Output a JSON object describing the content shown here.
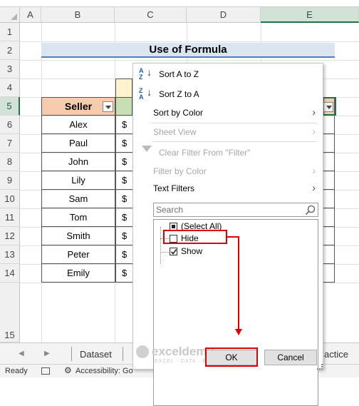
{
  "columns": [
    "A",
    "B",
    "C",
    "D",
    "E"
  ],
  "rows": [
    "1",
    "2",
    "3",
    "4",
    "5",
    "6",
    "7",
    "8",
    "9",
    "10",
    "11",
    "12",
    "13",
    "14",
    "15"
  ],
  "title": "Use of Formula",
  "table": {
    "header": "Seller",
    "sellers": [
      "Alex",
      "Paul",
      "John",
      "Lily",
      "Sam",
      "Tom",
      "Smith",
      "Peter",
      "Emily"
    ],
    "currency": "$"
  },
  "menu": {
    "sort_az": "Sort A to Z",
    "sort_za": "Sort Z to A",
    "sort_by_color": "Sort by Color",
    "sheet_view": "Sheet View",
    "clear_filter": "Clear Filter From \"Filter\"",
    "filter_by_color": "Filter by Color",
    "text_filters": "Text Filters",
    "search_placeholder": "Search",
    "items": [
      {
        "label": "(Select All)",
        "state": "partial"
      },
      {
        "label": "Hide",
        "state": "unchecked"
      },
      {
        "label": "Show",
        "state": "checked"
      }
    ],
    "ok": "OK",
    "cancel": "Cancel"
  },
  "tabs": {
    "dataset": "Dataset",
    "practice": "actice"
  },
  "status": {
    "ready": "Ready",
    "accessibility": "Accessibility: Go"
  },
  "watermark": {
    "brand": "exceldemy",
    "tagline": "EXCEL · DATA · BI"
  },
  "colors": {
    "header_fill": "#f8cbad",
    "accent_green": "#217346",
    "highlight_red": "#e00000",
    "title_bar": "#dbe5f1"
  }
}
